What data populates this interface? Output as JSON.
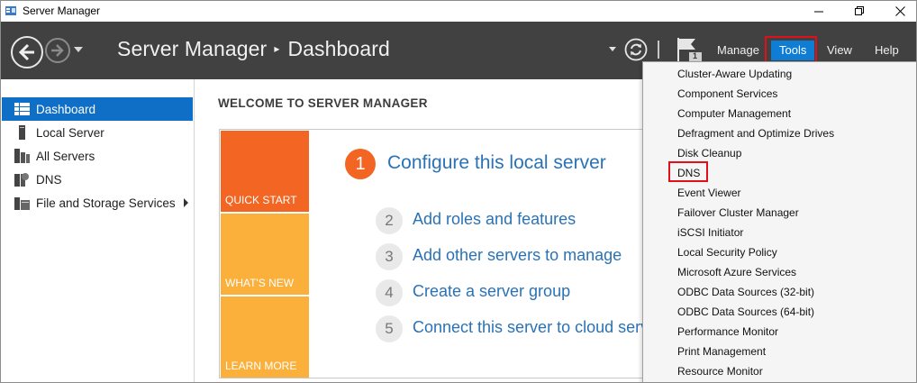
{
  "window": {
    "title": "Server Manager"
  },
  "header": {
    "breadcrumb_root": "Server Manager",
    "breadcrumb_separator": "▸",
    "breadcrumb_page": "Dashboard",
    "notification_count": "1",
    "menu": {
      "manage": "Manage",
      "tools": "Tools",
      "view": "View",
      "help": "Help"
    }
  },
  "sidebar": {
    "items": [
      {
        "label": "Dashboard",
        "icon": "dashboard-grid-icon",
        "active": true
      },
      {
        "label": "Local Server",
        "icon": "server-icon"
      },
      {
        "label": "All Servers",
        "icon": "servers-icon"
      },
      {
        "label": "DNS",
        "icon": "dns-icon"
      },
      {
        "label": "File and Storage Services",
        "icon": "storage-icon",
        "has_submenu": true
      }
    ]
  },
  "main": {
    "welcome_heading": "WELCOME TO SERVER MANAGER",
    "tiles": {
      "quick_start": "QUICK START",
      "whats_new": "WHAT'S NEW",
      "learn_more": "LEARN MORE"
    },
    "steps": [
      {
        "num": "1",
        "label": "Configure this local server"
      },
      {
        "num": "2",
        "label": "Add roles and features"
      },
      {
        "num": "3",
        "label": "Add other servers to manage"
      },
      {
        "num": "4",
        "label": "Create a server group"
      },
      {
        "num": "5",
        "label": "Connect this server to cloud serv"
      }
    ]
  },
  "tools_menu": {
    "items": [
      "Cluster-Aware Updating",
      "Component Services",
      "Computer Management",
      "Defragment and Optimize Drives",
      "Disk Cleanup",
      "DNS",
      "Event Viewer",
      "Failover Cluster Manager",
      "iSCSI Initiator",
      "Local Security Policy",
      "Microsoft Azure Services",
      "ODBC Data Sources (32-bit)",
      "ODBC Data Sources (64-bit)",
      "Performance Monitor",
      "Print Management",
      "Resource Monitor"
    ]
  },
  "colors": {
    "header_bg": "#414141",
    "accent_blue": "#0f6fc6",
    "quick_start": "#f26522",
    "tile_yellow": "#fbb03b",
    "link_blue": "#2a72b5",
    "highlight_red": "#e0101a"
  }
}
